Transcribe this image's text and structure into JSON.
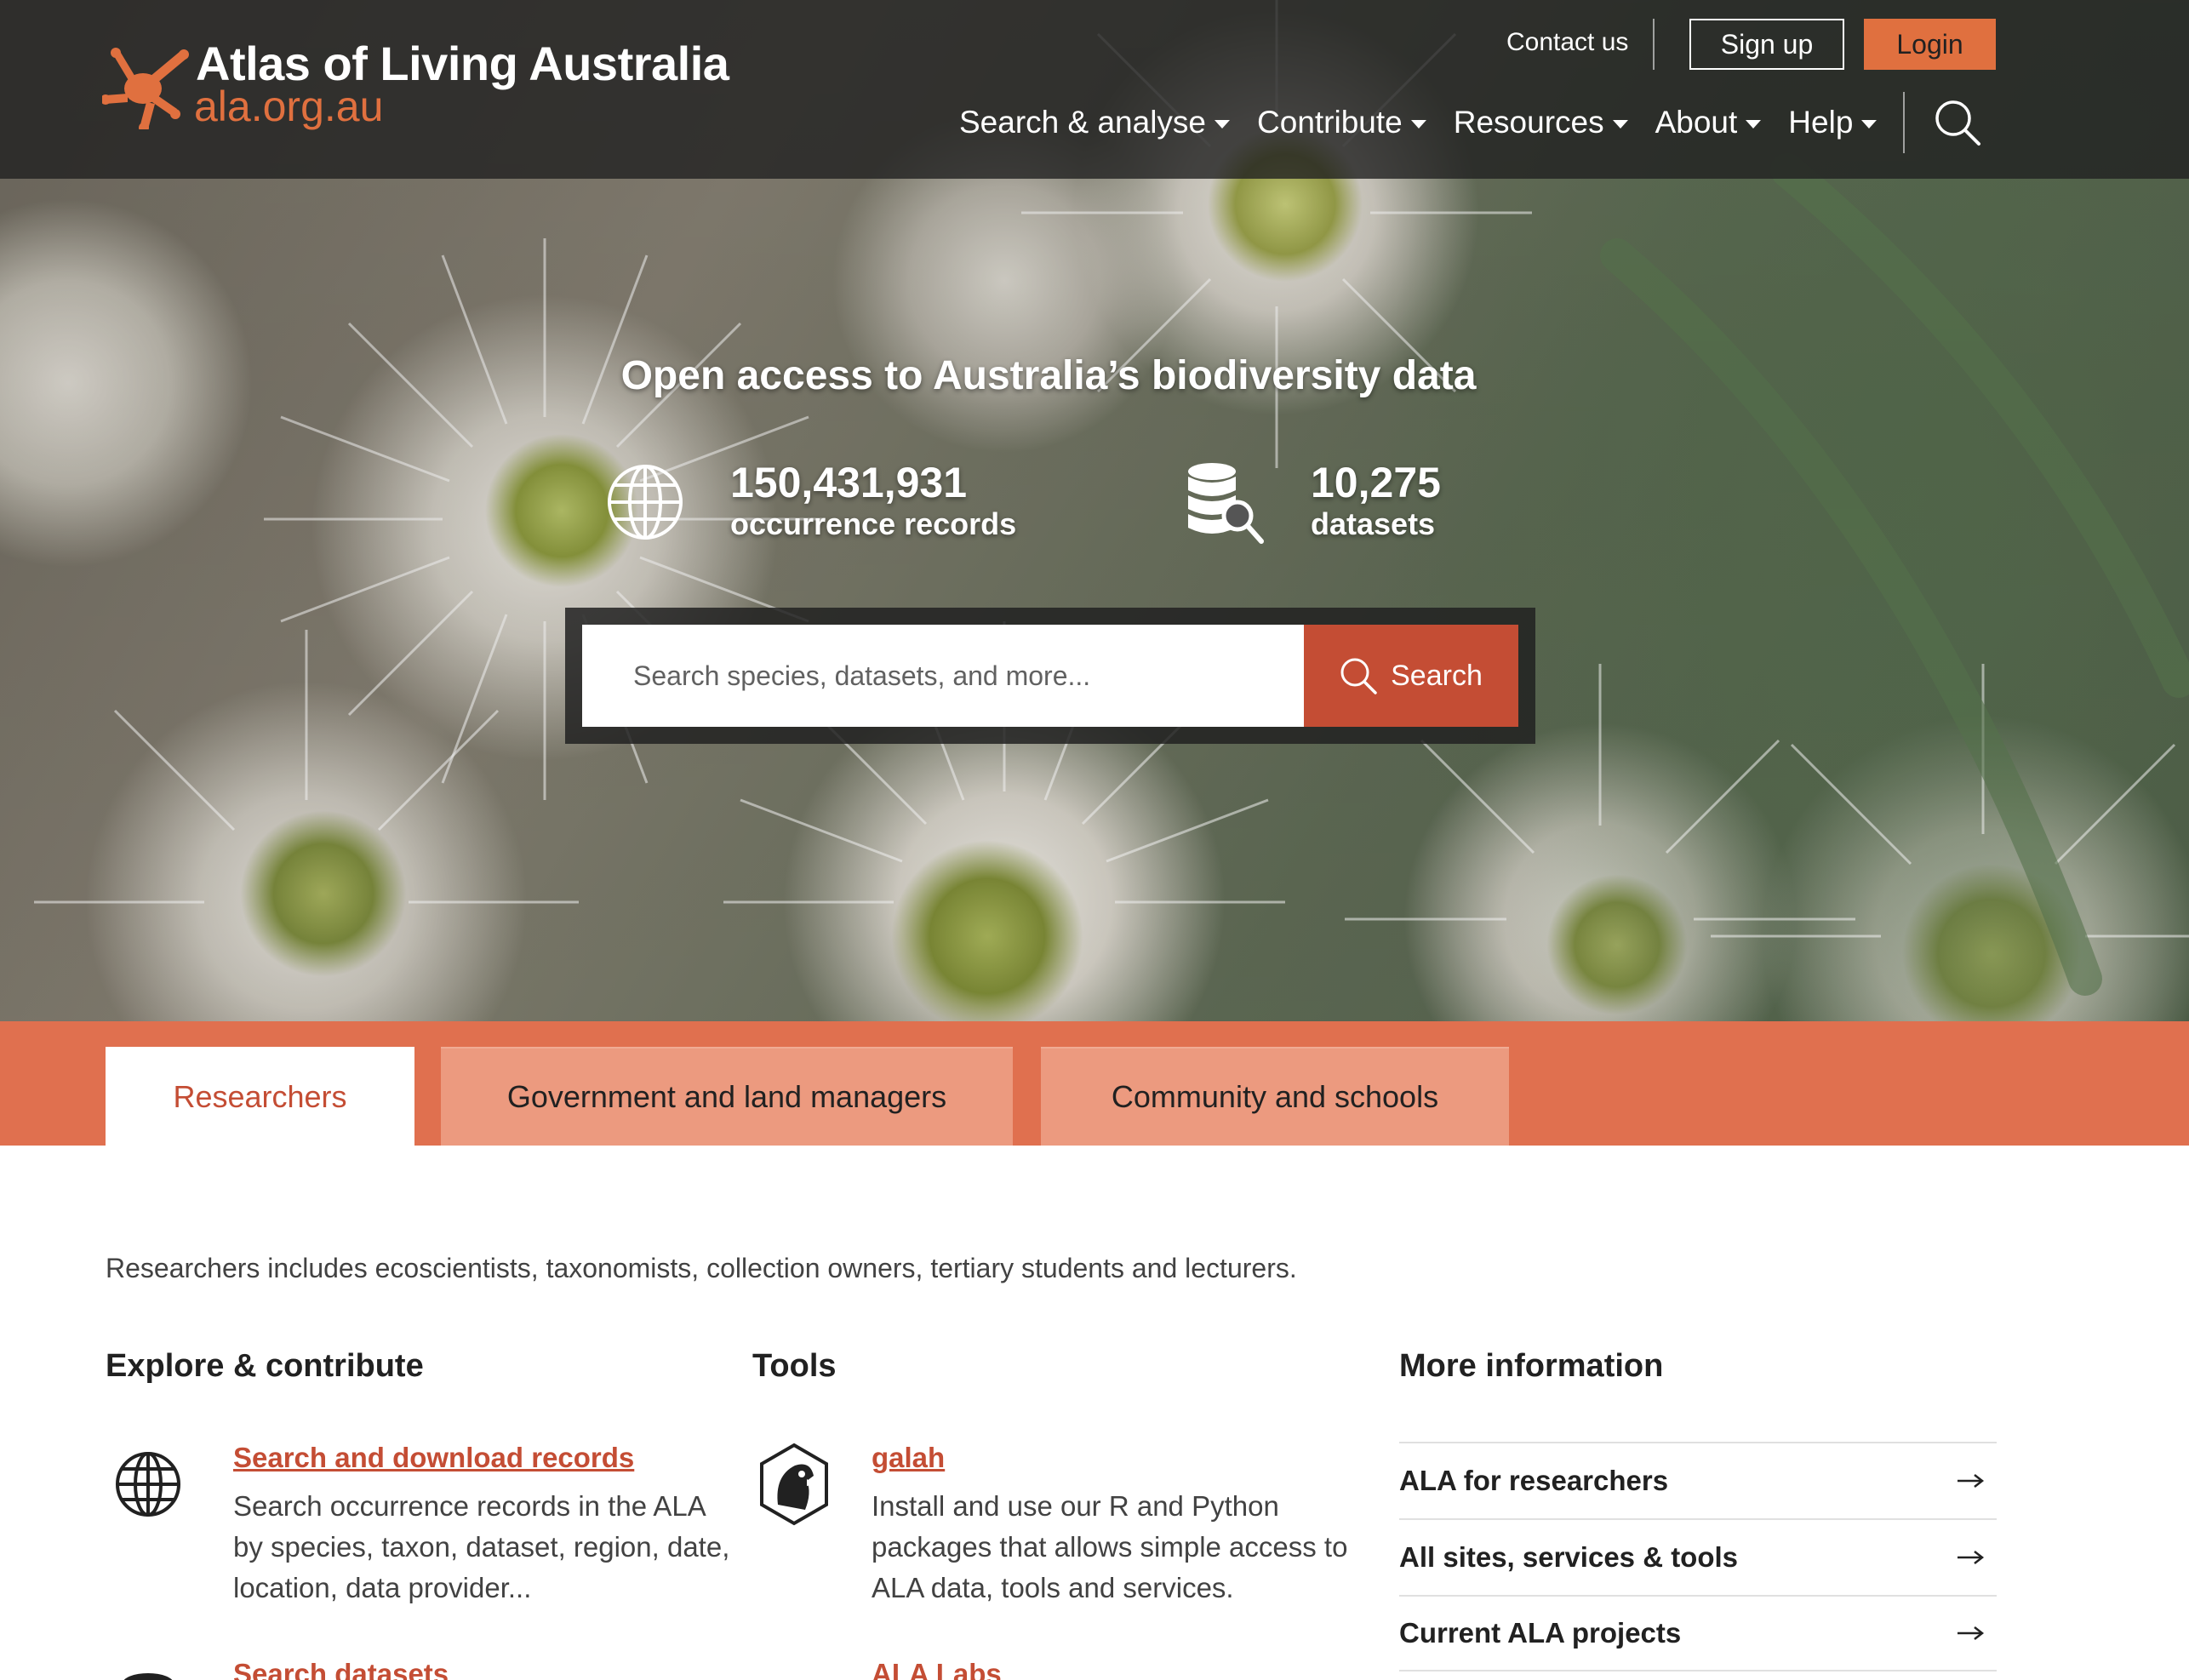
{
  "brand": {
    "title": "Atlas of Living Australia",
    "subtitle": "ala.org.au",
    "accent": "#e0703f"
  },
  "header": {
    "contact": "Contact us",
    "signup": "Sign up",
    "login": "Login",
    "nav": [
      "Search & analyse",
      "Contribute",
      "Resources",
      "About",
      "Help"
    ]
  },
  "hero": {
    "title": "Open access to Australia’s biodiversity data",
    "stats": [
      {
        "number": "150,431,931",
        "label": "occurrence records",
        "icon": "globe-icon"
      },
      {
        "number": "10,275",
        "label": "datasets",
        "icon": "database-search-icon"
      }
    ],
    "search": {
      "placeholder": "Search species, datasets, and more...",
      "button": "Search"
    }
  },
  "tabs": [
    "Researchers",
    "Government and land managers",
    "Community and schools"
  ],
  "content": {
    "intro": "Researchers includes ecoscientists, taxonomists, collection owners, tertiary students and lecturers.",
    "columns": {
      "explore": {
        "heading": "Explore & contribute",
        "items": [
          {
            "title": "Search and download records",
            "desc": "Search occurrence records in the ALA by species, taxon, dataset, region, date, location, data provider...",
            "icon": "globe-icon"
          },
          {
            "title": "Search datasets",
            "desc": "",
            "icon": "database-icon"
          }
        ]
      },
      "tools": {
        "heading": "Tools",
        "items": [
          {
            "title": "galah",
            "desc": "Install and use our R and Python packages that allows simple access to ALA data, tools and services.",
            "icon": "galah-icon"
          },
          {
            "title": "ALA Labs",
            "desc": "",
            "icon": "labs-icon"
          }
        ]
      },
      "more": {
        "heading": "More information",
        "links": [
          "ALA for researchers",
          "All sites, services & tools",
          "Current ALA projects"
        ]
      }
    }
  },
  "colors": {
    "tab_bar": "#e0704f",
    "tab_inactive": "#ec9a7f",
    "link": "#c44d34",
    "search_button": "#c44d34"
  }
}
